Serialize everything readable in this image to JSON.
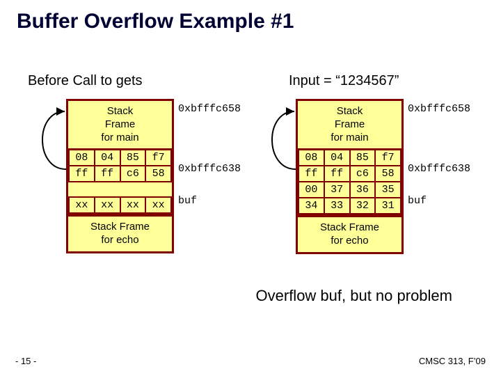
{
  "title": "Buffer Overflow Example #1",
  "left": {
    "header": "Before Call to gets",
    "frameMain": "Stack\nFrame\nfor main",
    "addrTop": "0xbfffc658",
    "row1": [
      "08",
      "04",
      "85",
      "f7"
    ],
    "row2": [
      "ff",
      "ff",
      "c6",
      "58"
    ],
    "addrRow2": "0xbfffc638",
    "row3": [
      "xx",
      "xx",
      "xx",
      "xx"
    ],
    "bufLabel": "buf",
    "frameEcho": "Stack Frame\nfor echo"
  },
  "right": {
    "header": "Input = “1234567”",
    "frameMain": "Stack\nFrame\nfor main",
    "addrTop": "0xbfffc658",
    "row1": [
      "08",
      "04",
      "85",
      "f7"
    ],
    "row2": [
      "ff",
      "ff",
      "c6",
      "58"
    ],
    "addrRow2": "0xbfffc638",
    "row3": [
      "00",
      "37",
      "36",
      "35"
    ],
    "row4": [
      "34",
      "33",
      "32",
      "31"
    ],
    "bufLabel": "buf",
    "frameEcho": "Stack Frame\nfor echo"
  },
  "conclusion": "Overflow buf, but no problem",
  "footerLeft": "- 15 -",
  "footerRight": "CMSC 313, F’09"
}
